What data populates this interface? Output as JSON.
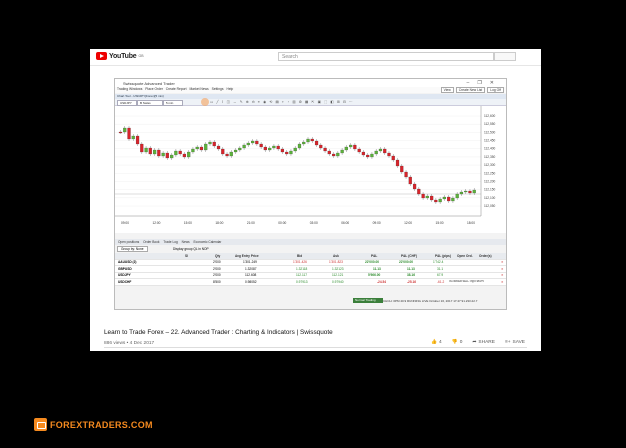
{
  "youtube": {
    "logo_text": "YouTube",
    "logo_sup": "GB",
    "search_placeholder": "Search"
  },
  "app": {
    "title": "Swissquote Advanced Trader",
    "menu": [
      "Trading Windows",
      "Place Order",
      "Create Report",
      "Market News",
      "Settings",
      "Help"
    ],
    "menu_right": [
      "View",
      "Create New List",
      "Log Off"
    ],
    "chart_tab": "Chart Tool - USDJPY[Forex](5 min)",
    "toolbar": {
      "symbol": "USDJPY",
      "type": "B Swiss",
      "interval": "5 min"
    },
    "chart": {
      "price_labels": [
        "112,600",
        "112,550",
        "112,500",
        "112,450",
        "112,400",
        "112,350",
        "112,300",
        "112,250",
        "112,200",
        "112,150",
        "112,100",
        "112,050"
      ],
      "time_labels": [
        "09:00",
        "12:00",
        "15:00",
        "18:00",
        "21:00",
        "00:00",
        "03:00",
        "06:00",
        "09:00",
        "12:00",
        "15:00",
        "18:00"
      ],
      "up_color": "#5cb33b",
      "down_color": "#d8242b"
    },
    "bottom_tabs": [
      "Open positions",
      "Order Book",
      "Trade Log",
      "News",
      "Economic Calendar"
    ],
    "filter": {
      "group_by": "Group by: None",
      "checkbox_label": "Display group QL in NOP"
    },
    "grid": {
      "headers": [
        "Sl",
        "Qty",
        "Avg Entry Price",
        "Bid",
        "Ask",
        "P&L",
        "P&L (CHF)",
        "P&L (pips)",
        "Open Ord.",
        "Order(s)"
      ],
      "rows": [
        {
          "symbol": "AAUUSD (2)",
          "qty": "2'000",
          "avg": "1'301.249",
          "bid": "1'301.426",
          "ask": "1'301.823",
          "pl": "22'000.00",
          "plchf": "22'000.00",
          "pips": "1'742.4",
          "orders": ""
        },
        {
          "symbol": "GBPUSD",
          "qty": "2'000",
          "avg": "1.32087",
          "bid": "1.32118",
          "ask": "1.32123",
          "pl": "11.13",
          "plchf": "11.13",
          "pips": "31.1",
          "orders": ""
        },
        {
          "symbol": "USDJPY",
          "qty": "2'000",
          "avg": "112.608",
          "bid": "112.117",
          "ask": "112.121",
          "pl": "5'966.00",
          "plchf": "38.16",
          "pips": "67.9",
          "orders": ""
        },
        {
          "symbol": "USDCHF",
          "qty": "8'500",
          "avg": "0.98052",
          "bid": "0.97913",
          "ask": "0.97940",
          "pl": "-24.54",
          "plchf": "-25.16",
          "pips": "-61.2",
          "orders": "IN-ORDER SELL: 8@0.98175"
        }
      ]
    },
    "status": {
      "badge": "Normal Trading",
      "text": "CHCH: 0PM 40.9 RUNNING LIVE October 16, 2017 17:47 91.233.22.7"
    }
  },
  "video": {
    "title": "Learn to Trade Forex – 22. Advanced Trader : Charting & Indicators | Swissquote",
    "meta": "886 views • 4 Dec 2017",
    "likes": "4",
    "dislikes": "0",
    "share": "SHARE",
    "save": "SAVE"
  },
  "brand": {
    "name": "FOREXTRADERS.COM",
    "color": "#f58a1f"
  }
}
